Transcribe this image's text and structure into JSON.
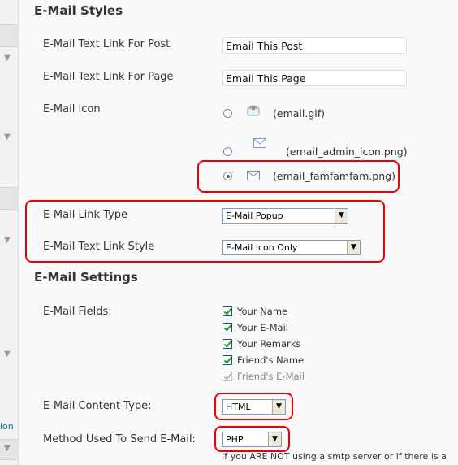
{
  "sections": {
    "styles_title": "E-Mail Styles",
    "settings_title": "E-Mail Settings"
  },
  "styles": {
    "post_label": "E-Mail Text Link For Post",
    "post_value": "Email This Post",
    "page_label": "E-Mail Text Link For Page",
    "page_value": "Email This Page",
    "icon_label": "E-Mail Icon",
    "icons": [
      {
        "label": "(email.gif)",
        "selected": false,
        "icon": "email-gif-icon"
      },
      {
        "label": "(email_admin_icon.png)",
        "selected": false,
        "icon": "envelope-admin-icon"
      },
      {
        "label": "(email_famfamfam.png)",
        "selected": true,
        "icon": "envelope-famfamfam-icon"
      }
    ],
    "link_type_label": "E-Mail Link Type",
    "link_type_value": "E-Mail Popup",
    "link_style_label": "E-Mail Text Link Style",
    "link_style_value": "E-Mail Icon Only"
  },
  "settings": {
    "fields_label": "E-Mail Fields:",
    "fields": [
      {
        "label": "Your Name",
        "checked": true,
        "disabled": false
      },
      {
        "label": "Your E-Mail",
        "checked": true,
        "disabled": false
      },
      {
        "label": "Your Remarks",
        "checked": true,
        "disabled": false
      },
      {
        "label": "Friend's Name",
        "checked": true,
        "disabled": false
      },
      {
        "label": "Friend's E-Mail",
        "checked": true,
        "disabled": true
      }
    ],
    "content_type_label": "E-Mail Content Type:",
    "content_type_value": "HTML",
    "method_label": "Method Used To Send E-Mail:",
    "method_value": "PHP",
    "method_note": "If you ARE NOT using a smtp server or if there is a"
  },
  "sidebar": {
    "link_fragment": "ion"
  },
  "colors": {
    "highlight": "#ee0000",
    "background": "#f9f9f9"
  }
}
